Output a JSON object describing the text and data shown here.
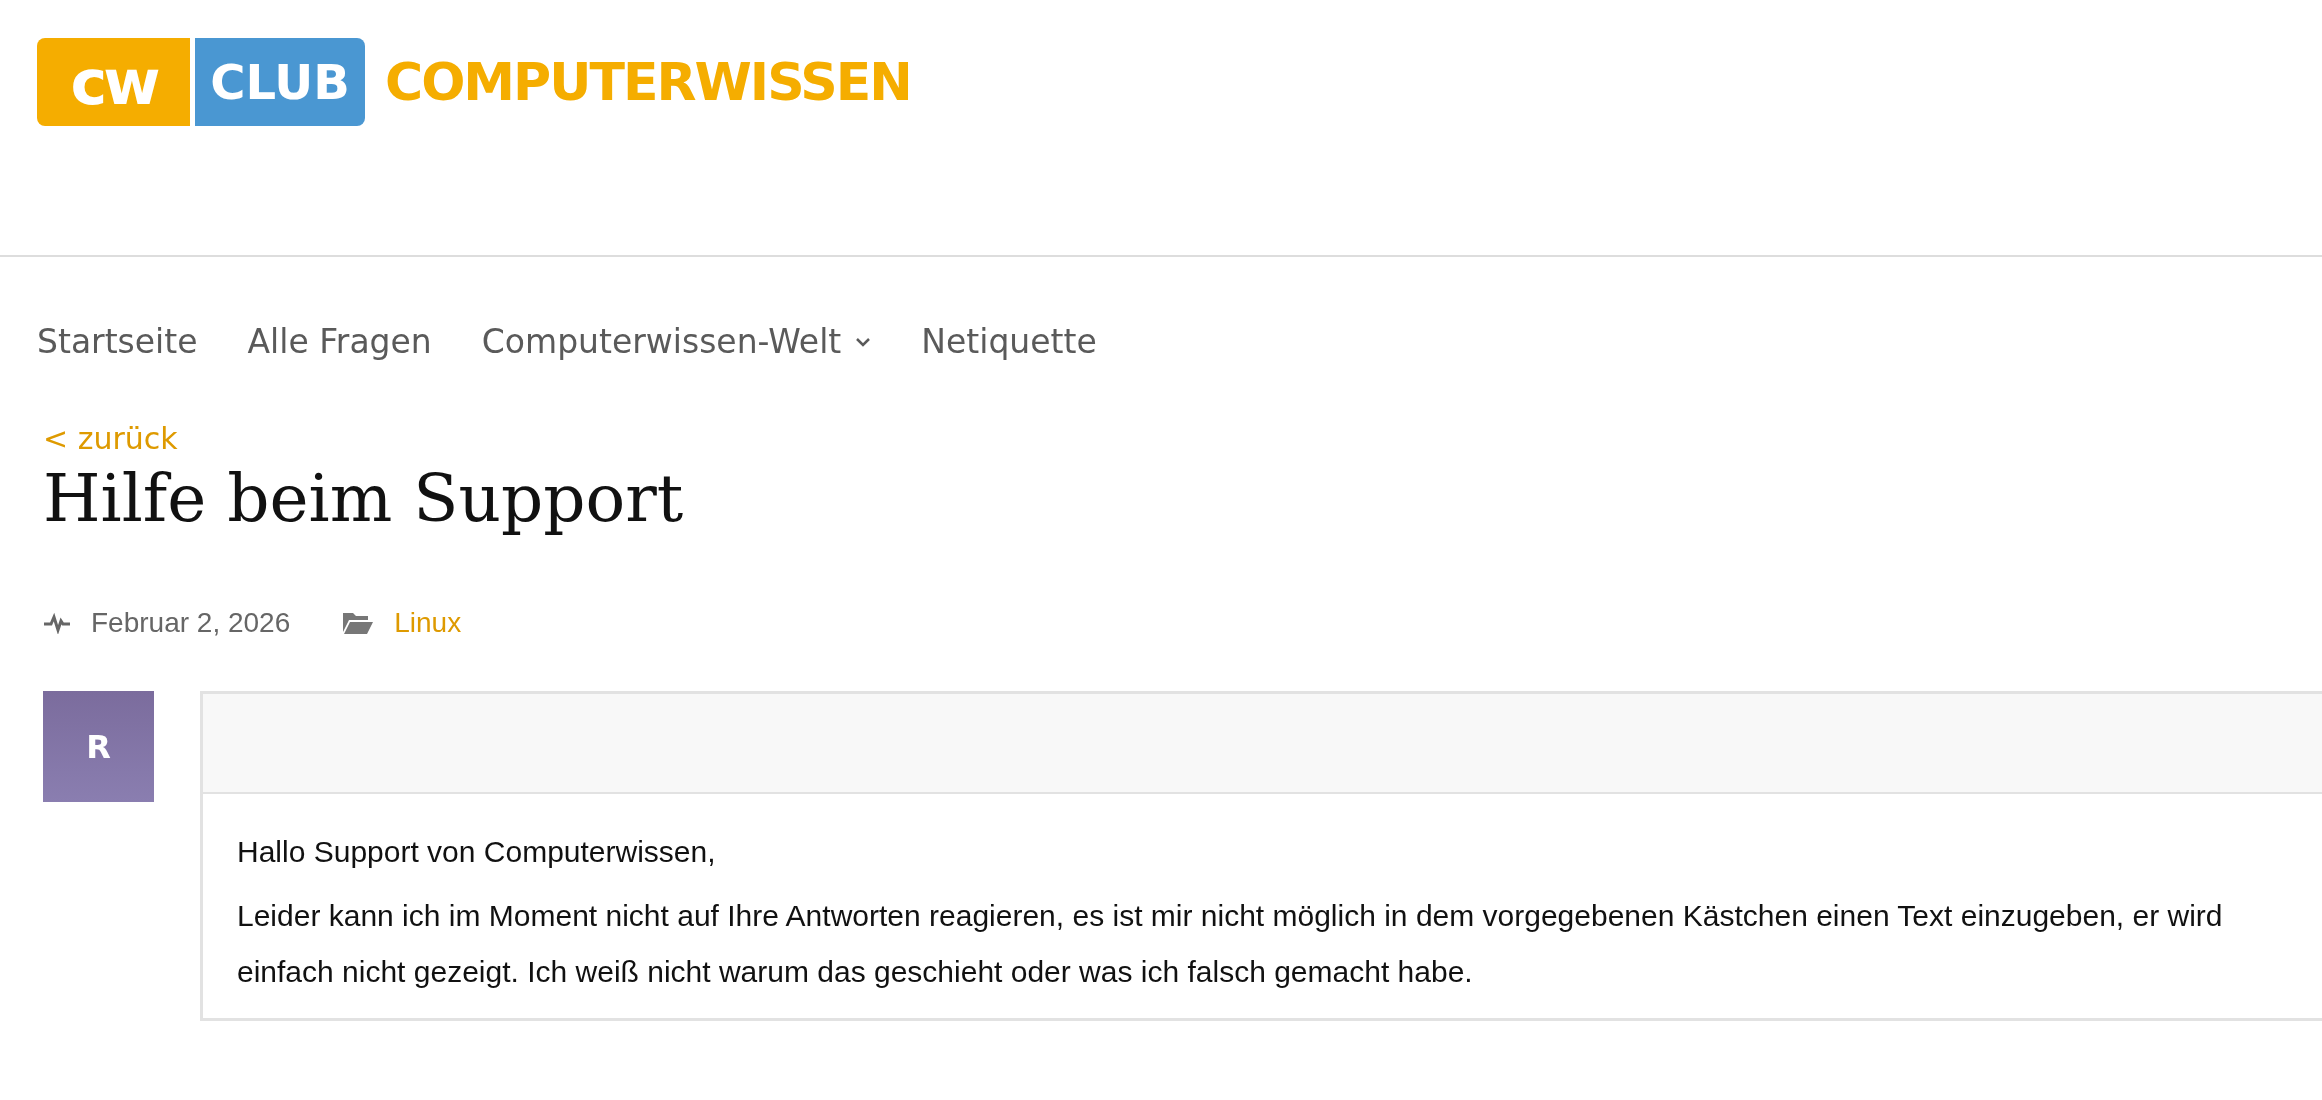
{
  "logo": {
    "mark": "cw",
    "club": "CLUB",
    "name": "COMPUTERWISSEN"
  },
  "nav": [
    {
      "label": "Startseite",
      "has_submenu": false
    },
    {
      "label": "Alle Fragen",
      "has_submenu": false
    },
    {
      "label": "Computerwissen-Welt",
      "has_submenu": true
    },
    {
      "label": "Netiquette",
      "has_submenu": false
    }
  ],
  "back_link": "< zurück",
  "title": "Hilfe beim Support",
  "meta": {
    "date": "Februar 2, 2026",
    "category": "Linux"
  },
  "post": {
    "avatar": "R",
    "paragraphs": [
      "Hallo Support von Computerwissen,",
      "Leider kann ich im Moment nicht auf Ihre Antworten reagieren, es ist mir nicht möglich in dem vorgegebenen Kästchen einen Text einzugeben, er wird einfach nicht gezeigt. Ich weiß nicht warum das geschieht oder was ich falsch gemacht habe."
    ]
  }
}
